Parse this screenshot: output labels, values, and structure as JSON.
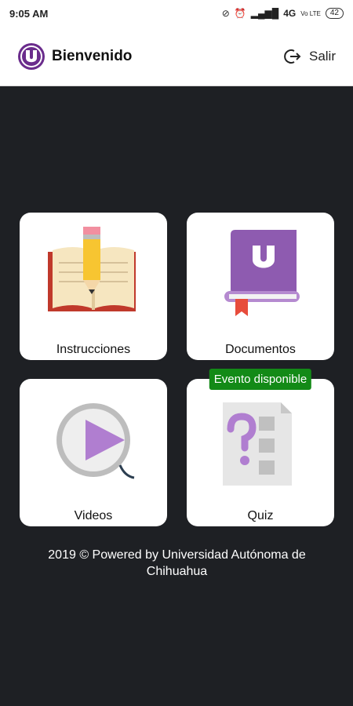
{
  "status_bar": {
    "time": "9:05 AM",
    "network": "4G",
    "volte": "Vo LTE",
    "battery": "42"
  },
  "app_bar": {
    "title": "Bienvenido",
    "logout_label": "Salir"
  },
  "menu": {
    "items": [
      {
        "label": "Instrucciones",
        "icon": "book-pencil-icon"
      },
      {
        "label": "Documentos",
        "icon": "purple-book-icon"
      },
      {
        "label": "Videos",
        "icon": "video-play-icon"
      },
      {
        "label": "Quiz",
        "icon": "quiz-question-icon",
        "badge": "Evento disponible"
      }
    ]
  },
  "footer": {
    "line1": "2019 © Powered by Universidad Autónoma de",
    "line2": "Chihuahua"
  },
  "colors": {
    "background": "#1e2024",
    "brand_purple": "#6a2c8c",
    "badge_green": "#138a17"
  }
}
